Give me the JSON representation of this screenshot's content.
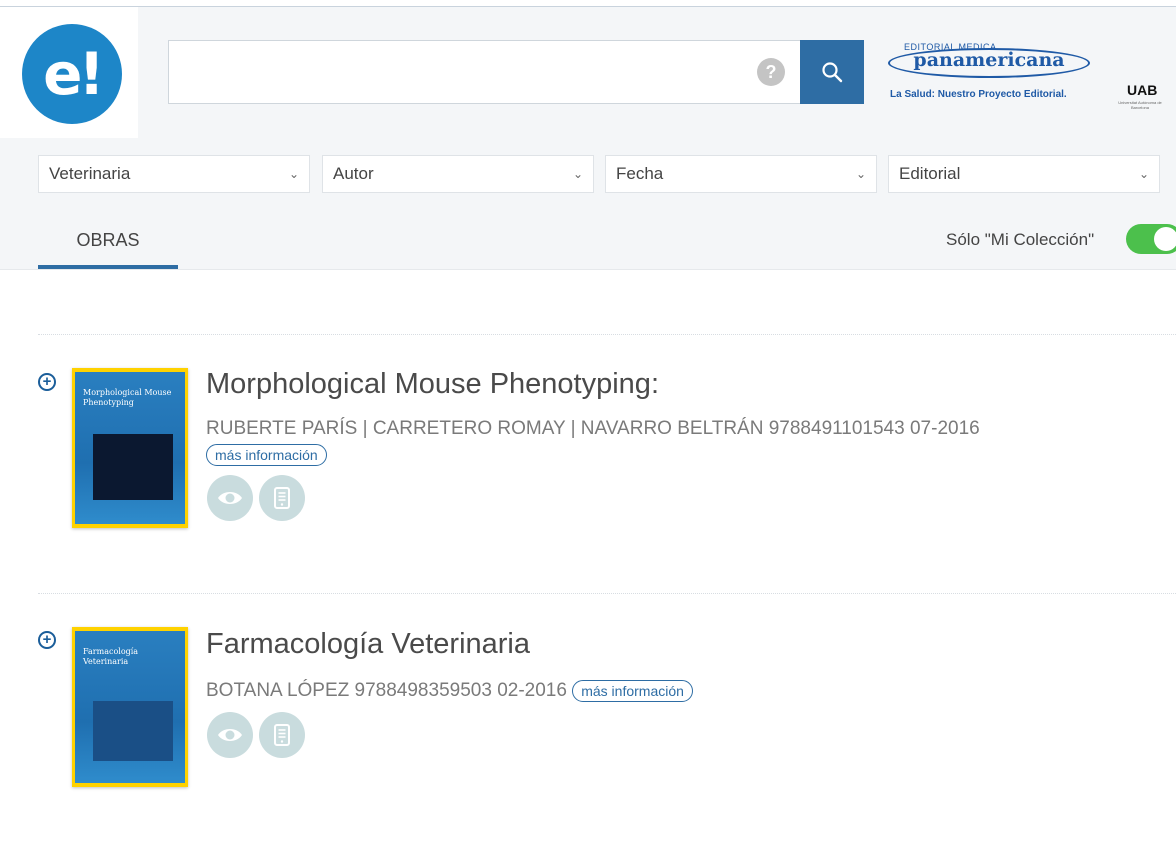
{
  "header": {
    "logo_text": "e!",
    "search": {
      "value": "",
      "placeholder": ""
    },
    "help_symbol": "?",
    "publisher": {
      "small": "EDITORIAL MEDICA",
      "name": "panamericana",
      "slogan": "La Salud: Nuestro Proyecto Editorial."
    },
    "institution": {
      "name": "UAB",
      "caption": "Universitat Autònoma de Barcelona"
    }
  },
  "filters": [
    {
      "label": "Veterinaria"
    },
    {
      "label": "Autor"
    },
    {
      "label": "Fecha"
    },
    {
      "label": "Editorial"
    }
  ],
  "tabs": [
    {
      "label": "OBRAS",
      "active": true
    }
  ],
  "collection_toggle": {
    "label": "Sólo \"Mi Colección\"",
    "on": true
  },
  "results": [
    {
      "title": "Morphological Mouse Phenotyping:",
      "authors": "RUBERTE PARÍS | CARRETERO ROMAY | NAVARRO BELTRÁN",
      "isbn": "9788491101543",
      "date": "07-2016",
      "more_label": "más información",
      "cover_title": "Morphological Mouse Phenotyping"
    },
    {
      "title": "Farmacología Veterinaria",
      "authors": "BOTANA LÓPEZ",
      "isbn": "9788498359503",
      "date": "02-2016",
      "more_label": "más información",
      "cover_title": "Farmacología Veterinaria"
    }
  ],
  "colors": {
    "accent": "#2e6da4",
    "logo": "#1d86c8",
    "toggle_on": "#4cc04c",
    "cover_yellow": "#ffd200",
    "action_bg": "#c9dcde"
  },
  "icons": {
    "search": "search-icon",
    "help": "help-icon",
    "chevron": "chevron-down-icon",
    "add": "plus-circle-icon",
    "view": "eye-icon",
    "read": "ebook-icon"
  }
}
